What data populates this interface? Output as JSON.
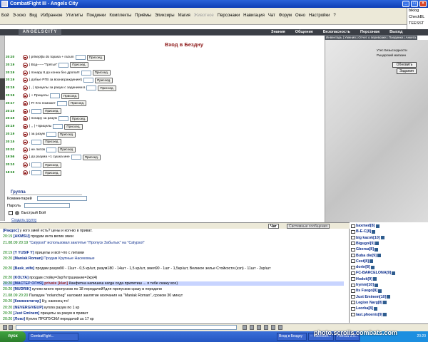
{
  "app": {
    "title": "CombatFight III - Angels City"
  },
  "menu": [
    "Вид",
    "Избранное",
    "Утилиты",
    "Поединки",
    "Комплекты",
    "Приёмы",
    "Эликсиры",
    "Магия",
    "Животное",
    "Персонажи",
    "Навигация",
    "Чат",
    "Форум",
    "Окно",
    "Настройки",
    "?"
  ],
  "menu_first": [
    "Бой",
    "Э-хоко"
  ],
  "right_panel": [
    "biklog",
    "CheckBL",
    "TEESST"
  ],
  "nav": {
    "logo": "ANGELSCITY",
    "items": [
      "Знания",
      "Общение",
      "Безопасность",
      "Персонаж",
      "Выход"
    ],
    "sub": "Инвентарь | Умения | Отчет о перевозке | Поединки | Анкета"
  },
  "page_title": "Вход в Бездну",
  "battle_rows": [
    {
      "time": "20:20",
      "text": "| prisepljiu do topasa + razum",
      "btn": "Присоед."
    },
    {
      "time": "20:19",
      "text": "| Вод------\"Трятья\"",
      "btn": "Присоед."
    },
    {
      "time": "20:19",
      "text": "| понару 8 до конна без дропа!!!",
      "btn": "Присоед."
    },
    {
      "time": "20:19",
      "text": "| добые РГВ за вознаграждение!)",
      "btn": "Присоед."
    },
    {
      "time": "20:19",
      "text": "| , | прицелы за разум с заданием в",
      "btn": "Присоед."
    },
    {
      "time": "20:19",
      "text": "| + Прицелы",
      "btn": "Присоед."
    },
    {
      "time": "20:17",
      "text": "| Рг Кто поможет",
      "btn": "Присоед."
    },
    {
      "time": "20:19",
      "text": "|",
      "btn": "Присоед."
    },
    {
      "time": "20:19",
      "text": "| понару за разум",
      "btn": "Присоед."
    },
    {
      "time": "20:19",
      "text": "| ,, | +прицелы",
      "btn": "Присоед."
    },
    {
      "time": "20:19",
      "text": "| за разум",
      "btn": "Присоед."
    },
    {
      "time": "20:15",
      "text": ",",
      "btn": "Присоед."
    },
    {
      "time": "20:02",
      "text": "| не литов",
      "btn": "Присоед."
    },
    {
      "time": "19:56",
      "text": "| до разума +1 сушка мне",
      "btn": "Присоед."
    },
    {
      "time": "20:10",
      "text": "|",
      "btn": "Присоед."
    },
    {
      "time": "18:19",
      "text": "|",
      "btn": "Присоед."
    }
  ],
  "group": {
    "title": "Группа",
    "comment_label": "Комментарий",
    "password_label": "Пароль",
    "quick_label": "Быстрый Бой",
    "create_link": "Создать группу"
  },
  "shops": [
    "Утес Безысходности",
    "Рыцарский магазин"
  ],
  "buttons": {
    "refresh": "Обновить",
    "tasks": "Задания"
  },
  "chat_tabs": [
    "Чат",
    "Системные сообщения"
  ],
  "chat": [
    {
      "ts": "",
      "sn": "[Paкдос]",
      "tx": " у кого змей есть? цены и кол-во в приват.",
      "hl": false
    },
    {
      "ts": "20:19",
      "sn": "[AKMSU]",
      "tx": " продам инта велик змеи",
      "hl": false
    },
    {
      "ts": "21.08.09 20:19",
      "sn": "",
      "tx": " \"Calypsol\" использовал заклятье \"Пропуск Забытых\" на \"Calypsol\"",
      "hl": false,
      "tb": true
    },
    {
      "ts": "20:19",
      "sn": "[Y YUSIF Y]",
      "tx": " прицелы и всё что с литами",
      "hl": false
    },
    {
      "ts": "20:20",
      "sn": "[Maniak Roman]",
      "tx": " Продам Крупные Насекомые",
      "hl": false,
      "tb": true
    },
    {
      "ts": "20:20",
      "sn": "[Bask_wife]",
      "tx": " продам разум90 - 11шт - 0,5 кр/шт, разум180 - 14шт - 1,5 кр/шт, змея90 - 1шт - 1,5кр/шт, Великое зелье Стойкости (кэп) - 11шт - 2кр/шт",
      "hl": false
    },
    {
      "ts": "20:20",
      "sn": "[KOLYA]",
      "tx": " продам стойку=2кр!!отршиание=2кр(4)",
      "hl": false
    },
    {
      "ts": "20:20",
      "sn": "[МАСТЕР ОГНЯ]",
      "ex": " private [klan]",
      "tx": " Канфетна напишеш кагда сода прилетиш ... я тебе скажу все)",
      "hl": true
    },
    {
      "ts": "20:20",
      "sn": "[MUDRIK]",
      "tx": " куплю много пропусков по 18 передачей!!для пропусков сразу в передачи",
      "hl": false
    },
    {
      "ts": "21.08.09 20:20",
      "sn": "",
      "tx": " Паладин \"nolancheg\" наложил заклятие молчания на \"Maniak Roman\", сроком 30 минут",
      "hl": false
    },
    {
      "ts": "20:20",
      "sn": "[Комментатор]",
      "tx": " Ну, наконец-то!",
      "hl": false
    },
    {
      "ts": "20:20",
      "sn": "[NEVERGIVEUP]",
      "tx": " куплю разум по 1 кр",
      "hl": false
    },
    {
      "ts": "20:20",
      "sn": "[Just Eminem]",
      "tx": " прицелы за разум в приват",
      "hl": false
    },
    {
      "ts": "20:20",
      "sn": "[Локо]",
      "tx": "       Куплю ПРОПУСКИ передачой за 17 кр",
      "hl": false
    }
  ],
  "users": [
    "baxmed[8]",
    "B-E-C[8]",
    "big kazok[10]",
    "Bigugol[9]",
    "Gborsa[8]",
    "Buba die[9]",
    "Cest[8]",
    "dorin[8]",
    "FC-BARCELONA[9]",
    "Hodok[9]",
    "hymm[10]",
    "Its Fuego[8]",
    "Just Eminem[10]",
    "Legion Narg[8]",
    "Leorka[8]",
    "last.phoenix[9]"
  ],
  "taskbar": {
    "start": "пуск",
    "tasks": [
      "CombatFight...",
      "Вход в Бездну",
      "-- Microsoft...",
      "HWISS 3.5..."
    ],
    "time": "20:20"
  },
  "watermark": "photo.scrolls.combats.com"
}
